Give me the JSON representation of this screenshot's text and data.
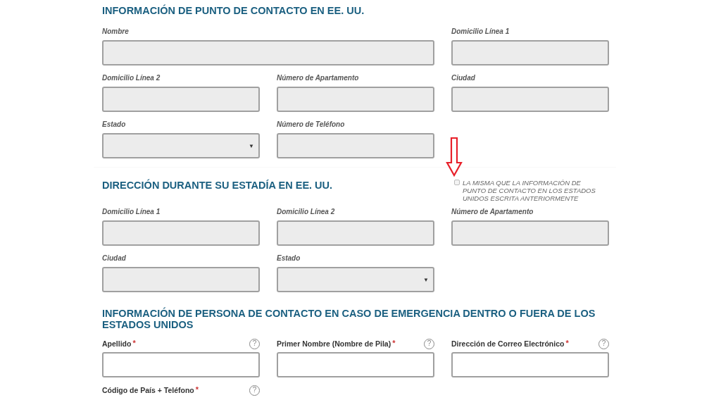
{
  "sections": [
    {
      "heading": "INFORMACIÓN DE PUNTO DE CONTACTO EN EE. UU.",
      "fields": [
        {
          "label": "Nombre",
          "kind": "text",
          "wide": true,
          "disabled": true
        },
        {
          "label": "Domicilio Línea 1",
          "kind": "text",
          "wide": false,
          "disabled": true
        },
        {
          "label": "Domicilio Línea 2",
          "kind": "text",
          "wide": false,
          "disabled": true
        },
        {
          "label": "Número de Apartamento",
          "kind": "text",
          "wide": false,
          "disabled": true
        },
        {
          "label": "Ciudad",
          "kind": "text",
          "wide": false,
          "disabled": true
        },
        {
          "label": "Estado",
          "kind": "select",
          "wide": false,
          "disabled": true,
          "caret": "▼"
        },
        {
          "label": "Número de Teléfono",
          "kind": "text",
          "wide": false,
          "disabled": true
        }
      ]
    },
    {
      "heading": "DIRECCIÓN DURANTE SU ESTADÍA EN EE. UU.",
      "checkbox": {
        "label": "LA MISMA QUE LA INFORMACIÓN DE PUNTO DE CONTACTO EN LOS ESTADOS UNIDOS ESCRITA ANTERIORMENTE",
        "checked": false
      },
      "fields": [
        {
          "label": "Domicilio Línea 1",
          "kind": "text",
          "wide": false,
          "disabled": true
        },
        {
          "label": "Domicilio Línea 2",
          "kind": "text",
          "wide": false,
          "disabled": true
        },
        {
          "label": "Número de Apartamento",
          "kind": "text",
          "wide": false,
          "disabled": true
        },
        {
          "label": "Ciudad",
          "kind": "text",
          "wide": false,
          "disabled": true
        },
        {
          "label": "Estado",
          "kind": "select",
          "wide": false,
          "disabled": true,
          "caret": "▼"
        }
      ]
    },
    {
      "heading": "INFORMACIÓN DE PERSONA DE CONTACTO EN CASO DE EMERGENCIA DENTRO O FUERA DE LOS ESTADOS UNIDOS",
      "fields": [
        {
          "label": "Apellido",
          "required": "*",
          "help": "?",
          "kind": "text",
          "wide": false,
          "disabled": false
        },
        {
          "label": "Primer Nombre (Nombre de Pila)",
          "required": "*",
          "help": "?",
          "kind": "text",
          "wide": false,
          "disabled": false
        },
        {
          "label": "Dirección de Correo Electrónico",
          "required": "*",
          "help": "?",
          "kind": "text",
          "wide": false,
          "disabled": false
        },
        {
          "label": "Código de País + Teléfono",
          "required": "*",
          "help": "?",
          "kind": "cut"
        }
      ]
    }
  ]
}
